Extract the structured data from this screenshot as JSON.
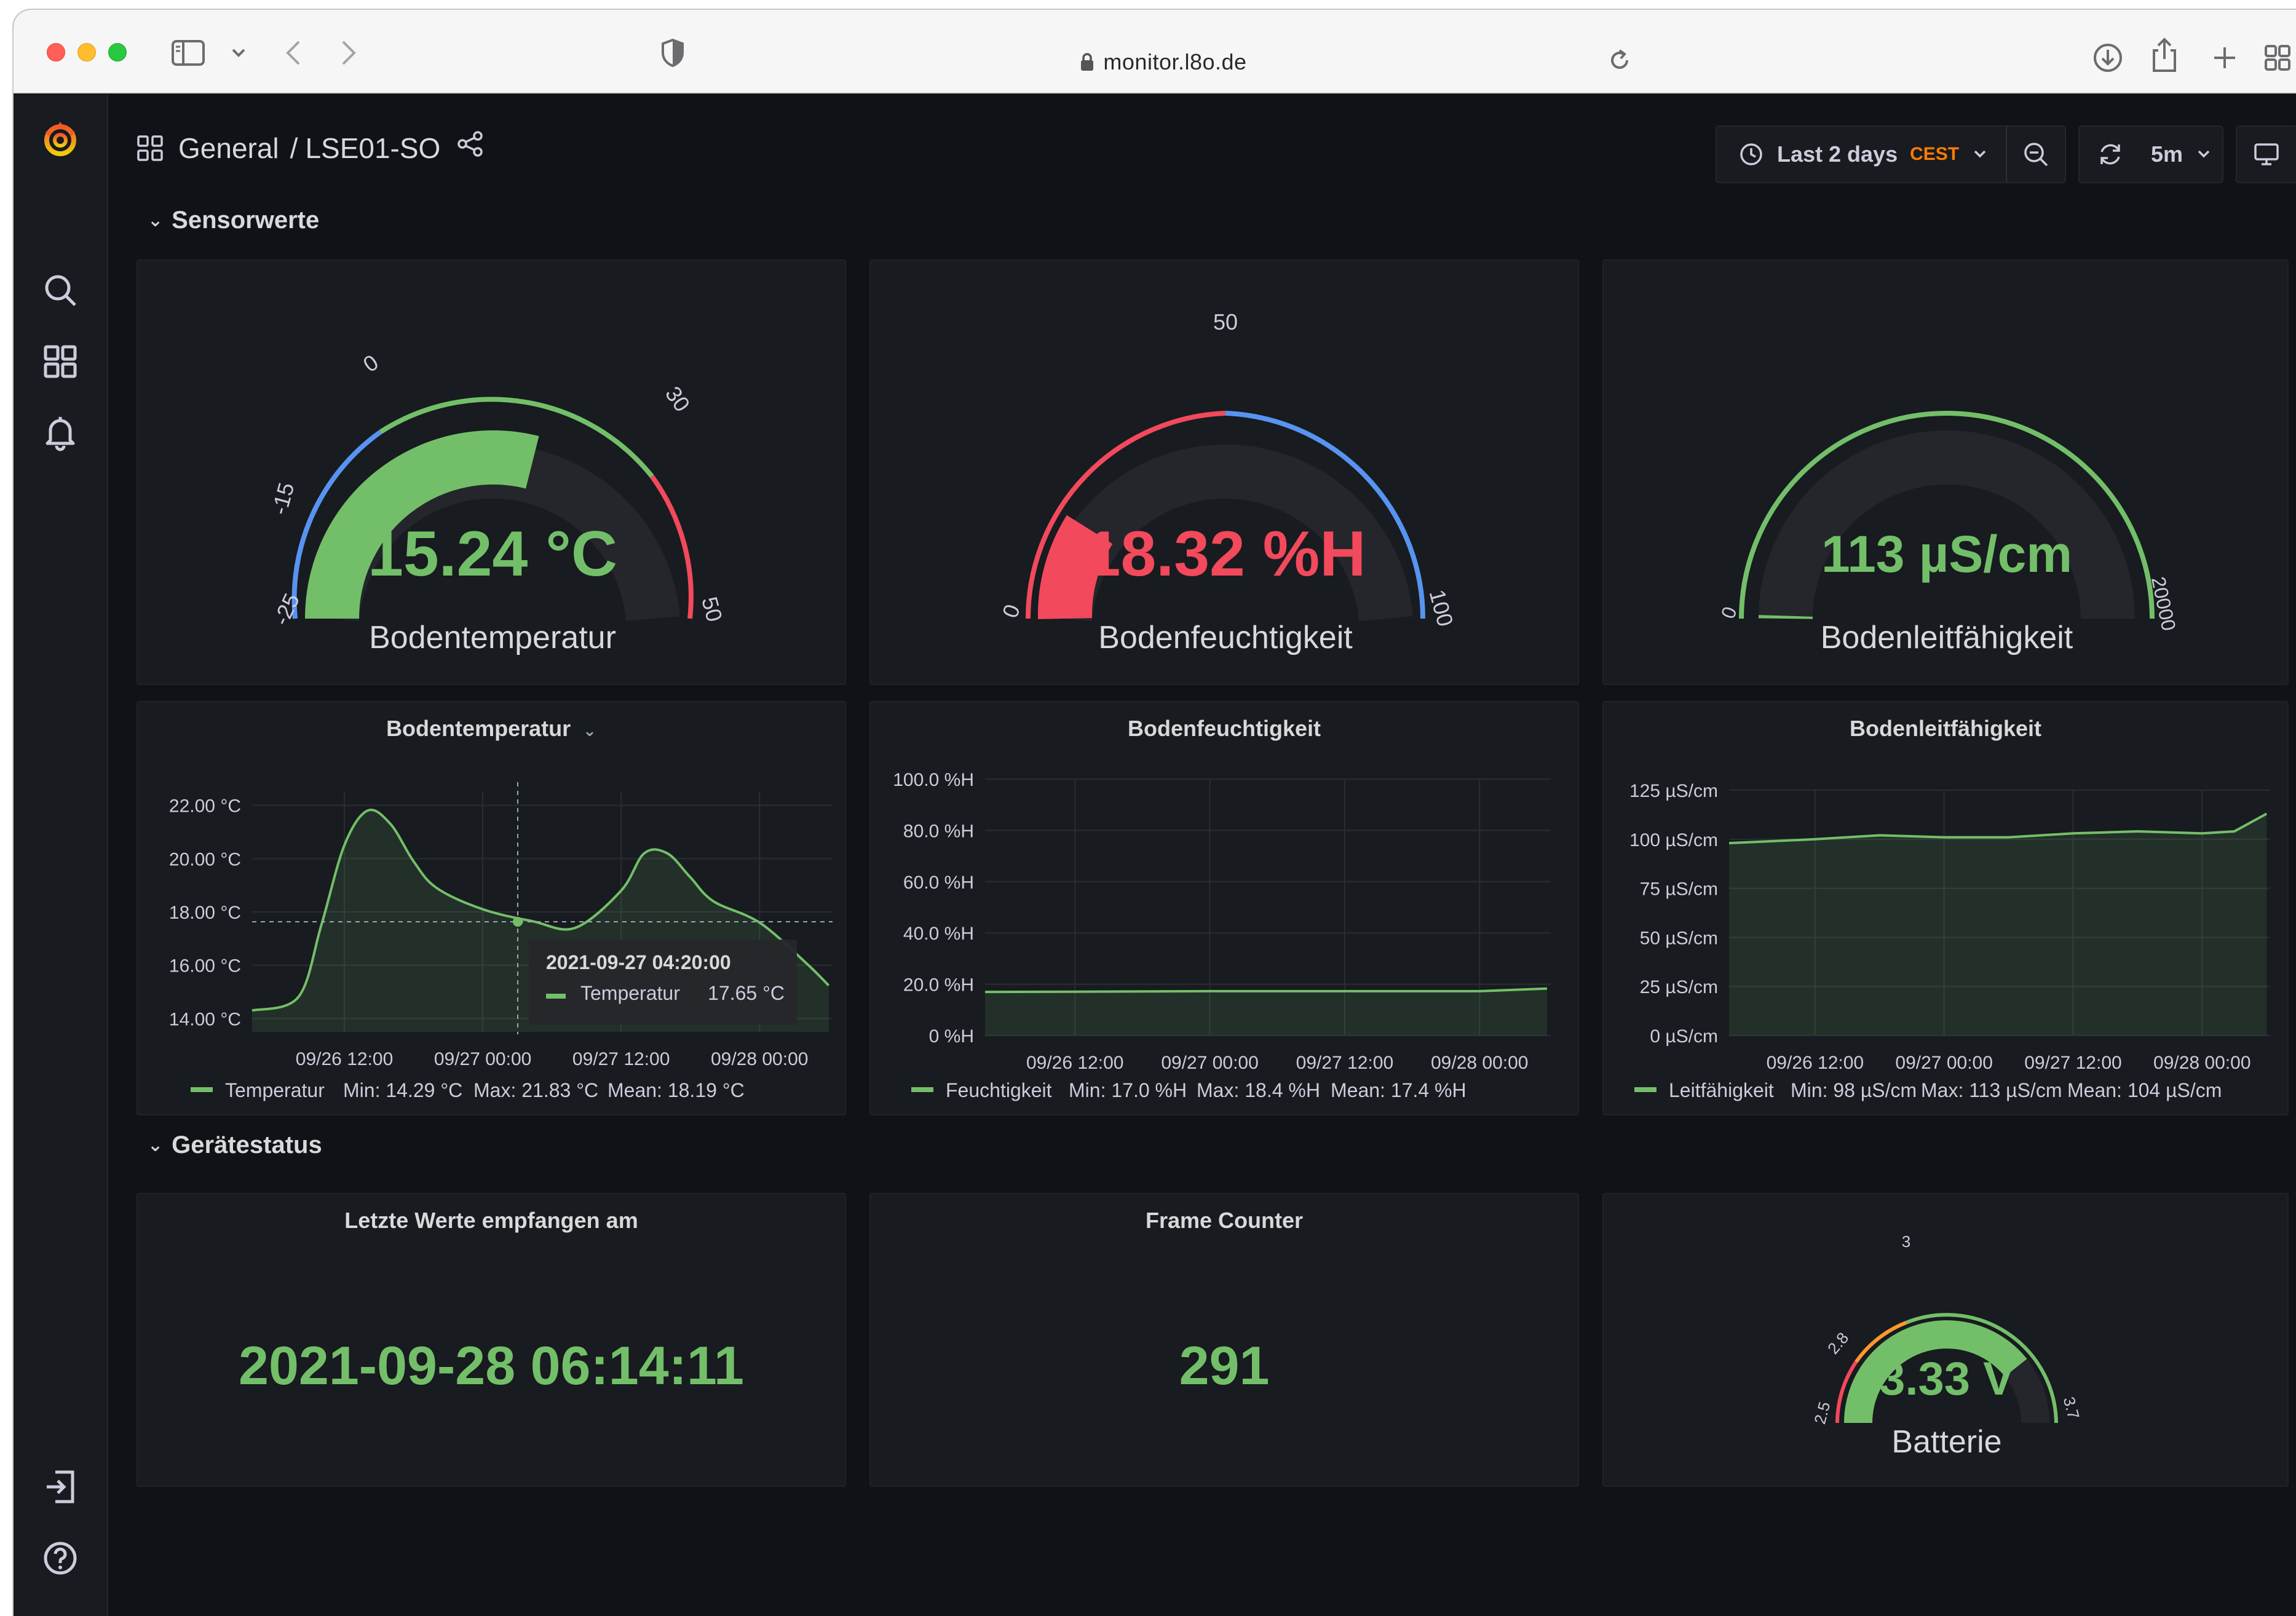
{
  "browser": {
    "url": "monitor.l8o.de"
  },
  "breadcrumb": {
    "folder": "General",
    "dashboard": "LSE01-SO"
  },
  "toolbar": {
    "time_range": "Last 2 days",
    "timezone": "CEST",
    "refresh_interval": "5m"
  },
  "rows": {
    "sensors": "Sensorwerte",
    "device": "Gerätestatus"
  },
  "gauges": {
    "temperature": {
      "value": "15.24 °C",
      "label": "Bodentemperatur",
      "numeric": 15.24,
      "min": -25,
      "max": 50,
      "ticks": [
        "-25",
        "-15",
        "0",
        "30",
        "50"
      ],
      "color": "#73bf69"
    },
    "moisture": {
      "value": "18.32 %H",
      "label": "Bodenfeuchtigkeit",
      "numeric": 18.32,
      "min": 0,
      "max": 100,
      "ticks": [
        "0",
        "50",
        "100"
      ],
      "color": "#f2495c"
    },
    "conductivity": {
      "value": "113 µS/cm",
      "label": "Bodenleitfähigkeit",
      "numeric": 113,
      "min": 0,
      "max": 20000,
      "ticks": [
        "0",
        "20000"
      ],
      "color": "#73bf69"
    },
    "battery": {
      "value": "3.33 V",
      "label": "Batterie",
      "numeric": 3.33,
      "min": 2.5,
      "max": 3.7,
      "ticks": [
        "2.5",
        "2.8",
        "3",
        "3.7"
      ],
      "color": "#73bf69"
    }
  },
  "graphs": {
    "temperature": {
      "title": "Bodentemperatur",
      "y_ticks": [
        "22.00 °C",
        "20.00 °C",
        "18.00 °C",
        "16.00 °C",
        "14.00 °C"
      ],
      "x_ticks": [
        "09/26 12:00",
        "09/27 00:00",
        "09/27 12:00",
        "09/28 00:00"
      ],
      "legend": {
        "name": "Temperatur",
        "min": "Min: 14.29 °C",
        "max": "Max: 21.83 °C",
        "mean": "Mean: 18.19 °C"
      },
      "tooltip": {
        "time": "2021-09-27 04:20:00",
        "series": "Temperatur",
        "value": "17.65 °C"
      }
    },
    "moisture": {
      "title": "Bodenfeuchtigkeit",
      "y_ticks": [
        "100.0 %H",
        "80.0 %H",
        "60.0 %H",
        "40.0 %H",
        "20.0 %H",
        "0 %H"
      ],
      "x_ticks": [
        "09/26 12:00",
        "09/27 00:00",
        "09/27 12:00",
        "09/28 00:00"
      ],
      "legend": {
        "name": "Feuchtigkeit",
        "min": "Min: 17.0 %H",
        "max": "Max: 18.4 %H",
        "mean": "Mean: 17.4 %H"
      }
    },
    "conductivity": {
      "title": "Bodenleitfähigkeit",
      "y_ticks": [
        "125 µS/cm",
        "100 µS/cm",
        "75 µS/cm",
        "50 µS/cm",
        "25 µS/cm",
        "0 µS/cm"
      ],
      "x_ticks": [
        "09/26 12:00",
        "09/27 00:00",
        "09/27 12:00",
        "09/28 00:00"
      ],
      "legend": {
        "name": "Leitfähigkeit",
        "min": "Min: 98 µS/cm",
        "max": "Max: 113 µS/cm",
        "mean": "Mean: 104 µS/cm"
      }
    }
  },
  "stats": {
    "last_received": {
      "title": "Letzte Werte empfangen am",
      "value": "2021-09-28 06:14:11"
    },
    "frame_counter": {
      "title": "Frame Counter",
      "value": "291"
    }
  },
  "chart_data": [
    {
      "type": "line",
      "series": [
        {
          "name": "Temperatur",
          "x": [
            "09/26 04:00",
            "09/26 08:00",
            "09/26 10:00",
            "09/26 12:00",
            "09/26 14:00",
            "09/26 16:00",
            "09/26 18:00",
            "09/26 20:00",
            "09/27 00:00",
            "09/27 04:20",
            "09/27 08:00",
            "09/27 12:00",
            "09/27 14:00",
            "09/27 16:00",
            "09/27 18:00",
            "09/27 20:00",
            "09/28 00:00",
            "09/28 04:00",
            "09/28 06:00"
          ],
          "values": [
            14.3,
            14.8,
            17.5,
            20.5,
            21.8,
            21.3,
            19.9,
            18.9,
            18.1,
            17.65,
            17.4,
            18.8,
            20.2,
            20.2,
            19.3,
            18.4,
            17.6,
            16.1,
            15.24
          ]
        }
      ],
      "ylim": [
        13.5,
        22.5
      ]
    },
    {
      "type": "line",
      "series": [
        {
          "name": "Feuchtigkeit",
          "x": [
            "09/26 04:00",
            "09/26 12:00",
            "09/27 00:00",
            "09/27 12:00",
            "09/28 00:00",
            "09/28 06:00"
          ],
          "values": [
            17.0,
            17.1,
            17.3,
            17.3,
            17.3,
            18.32
          ]
        }
      ],
      "ylim": [
        0,
        100
      ]
    },
    {
      "type": "line",
      "series": [
        {
          "name": "Leitfähigkeit",
          "x": [
            "09/26 04:00",
            "09/26 12:00",
            "09/26 18:00",
            "09/27 00:00",
            "09/27 06:00",
            "09/27 12:00",
            "09/27 18:00",
            "09/28 00:00",
            "09/28 03:00",
            "09/28 06:00"
          ],
          "values": [
            98,
            100,
            102,
            101,
            101,
            103,
            104,
            103,
            104,
            113
          ]
        }
      ],
      "ylim": [
        0,
        125
      ]
    }
  ]
}
